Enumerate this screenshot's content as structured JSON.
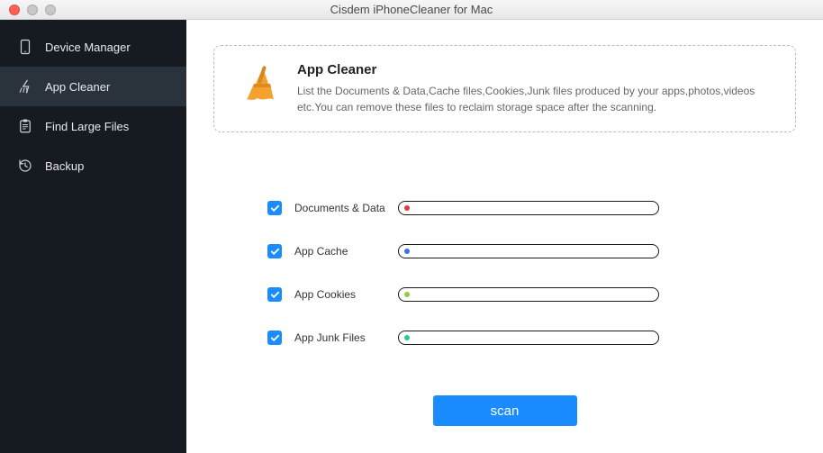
{
  "window": {
    "title": "Cisdem iPhoneCleaner for Mac"
  },
  "sidebar": {
    "items": [
      {
        "label": "Device Manager"
      },
      {
        "label": "App Cleaner"
      },
      {
        "label": "Find Large Files"
      },
      {
        "label": "Backup"
      }
    ]
  },
  "info": {
    "title": "App Cleaner",
    "desc": "List the Documents & Data,Cache files,Cookies,Junk files produced by your apps,photos,videos etc.You can remove these files to reclaim storage space after the scanning."
  },
  "rows": [
    {
      "label": "Documents & Data",
      "dot": "#e6393e"
    },
    {
      "label": "App Cache",
      "dot": "#3a6ff0"
    },
    {
      "label": "App Cookies",
      "dot": "#8fce3a"
    },
    {
      "label": "App Junk Files",
      "dot": "#2fc98e"
    }
  ],
  "actions": {
    "scan": "scan"
  }
}
